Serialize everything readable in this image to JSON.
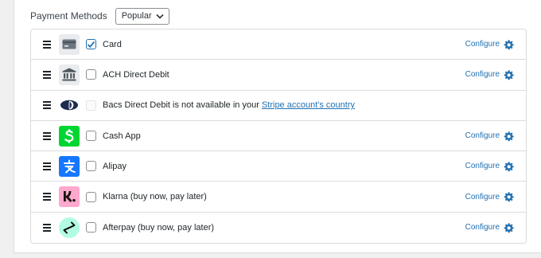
{
  "header": {
    "title": "Payment Methods",
    "sort_value": "Popular"
  },
  "methods": [
    {
      "name": "Card",
      "icon": "card-icon",
      "checked": true,
      "configure_label": "Configure"
    },
    {
      "name": "ACH Direct Debit",
      "icon": "bank-icon",
      "checked": false,
      "configure_label": "Configure"
    },
    {
      "name": "Bacs Direct Debit",
      "icon": "bacs-icon",
      "checked": false,
      "disabled": true,
      "unavailable_text": "Bacs Direct Debit is not available in your ",
      "link_text": "Stripe account's country"
    },
    {
      "name": "Cash App",
      "icon": "cash-app-icon",
      "checked": false,
      "configure_label": "Configure"
    },
    {
      "name": "Alipay",
      "icon": "alipay-icon",
      "checked": false,
      "configure_label": "Configure"
    },
    {
      "name": "Klarna (buy now, pay later)",
      "icon": "klarna-icon",
      "checked": false,
      "configure_label": "Configure"
    },
    {
      "name": "Afterpay (buy now, pay later)",
      "icon": "afterpay-icon",
      "checked": false,
      "configure_label": "Configure"
    }
  ],
  "colors": {
    "link": "#2271b1",
    "cash_app": "#00d632",
    "alipay": "#1677ff",
    "klarna": "#ffa8cd",
    "afterpay": "#b2fce4"
  }
}
